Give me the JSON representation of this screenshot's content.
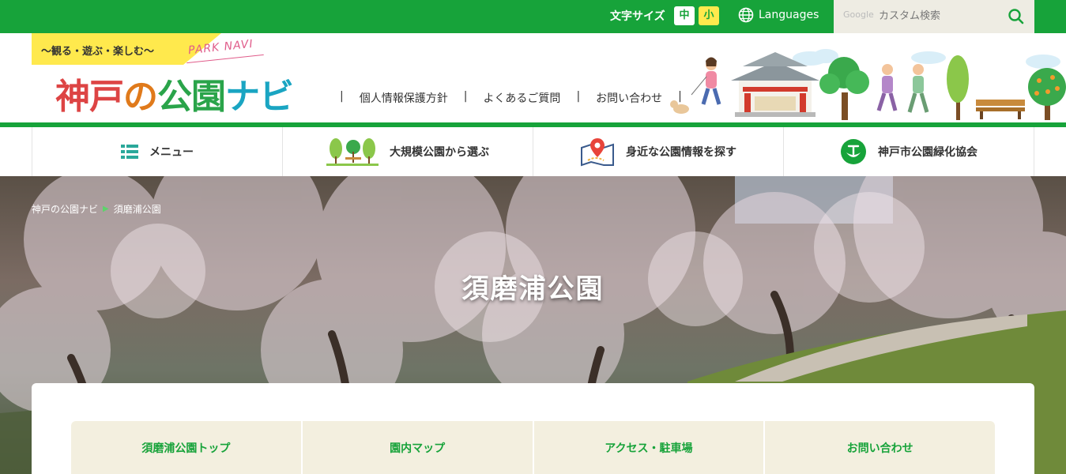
{
  "topbar": {
    "font_size_label": "文字サイズ",
    "font_size_mid": "中",
    "font_size_small": "小",
    "languages": "Languages",
    "search_brand": "Google",
    "search_placeholder": "カスタム検索"
  },
  "header": {
    "tagline": "〜観る・遊ぶ・楽しむ〜",
    "park_navi": "PARK NAVI",
    "logo": {
      "a": "神戸",
      "b": "の",
      "c": "公園",
      "d": "ナビ"
    },
    "links": [
      "個人情報保護方針",
      "よくあるご質問",
      "お問い合わせ"
    ],
    "separator": "|"
  },
  "menu": [
    {
      "label": "メニュー",
      "icon": "list-icon"
    },
    {
      "label": "大規模公園から選ぶ",
      "icon": "park-trees-icon"
    },
    {
      "label": "身近な公園情報を探す",
      "icon": "map-pin-icon"
    },
    {
      "label": "神戸市公園緑化協会",
      "icon": "association-emblem-icon"
    }
  ],
  "breadcrumb": [
    "神戸の公園ナビ",
    "須磨浦公園"
  ],
  "hero": {
    "title": "須磨浦公園"
  },
  "subnav": [
    "須磨浦公園トップ",
    "園内マップ",
    "アクセス・駐車場",
    "お問い合わせ"
  ],
  "colors": {
    "brand_green": "#17a33a",
    "accent_yellow": "#ffe94d",
    "tab_bg": "#f3efdf"
  }
}
